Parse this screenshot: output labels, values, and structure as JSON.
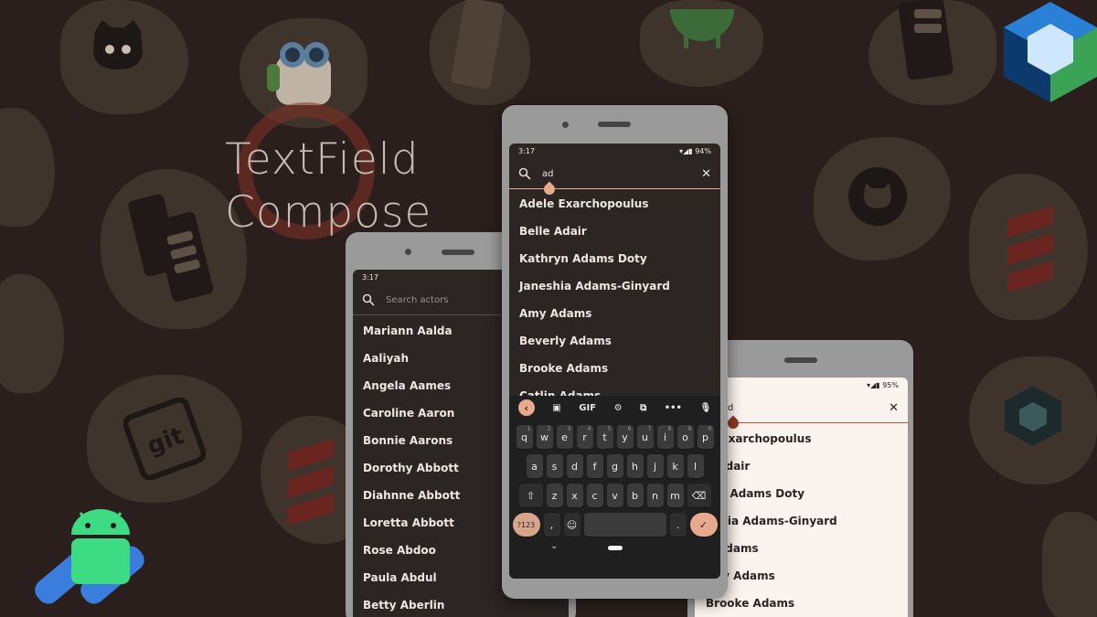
{
  "hero": {
    "title_line1": "TextField",
    "title_line2": "Compose"
  },
  "colors": {
    "background": "#2a1f1c",
    "blob": "#3e342b",
    "accent": "#e9a98c",
    "accent_light": "#b5573e",
    "dark_surface": "#2b2523",
    "light_surface": "#fbf3ee"
  },
  "left_phone": {
    "time": "3:17",
    "search_placeholder": "Search actors",
    "items": [
      "Mariann Aalda",
      "Aaliyah",
      "Angela Aames",
      "Caroline Aaron",
      "Bonnie Aarons",
      "Dorothy Abbott",
      "Diahnne Abbott",
      "Loretta Abbott",
      "Rose Abdoo",
      "Paula Abdul",
      "Betty Aberlin"
    ]
  },
  "center_phone": {
    "time": "3:17",
    "battery": "94%",
    "query": "ad",
    "items": [
      "Adele Exarchopoulus",
      "Belle Adair",
      "Kathryn Adams Doty",
      "Janeshia Adams-Ginyard",
      "Amy Adams",
      "Beverly Adams",
      "Brooke Adams",
      "Catlin Adams"
    ],
    "keyboard": {
      "toolbar": {
        "gif": "GIF"
      },
      "row1": [
        "q",
        "w",
        "e",
        "r",
        "t",
        "y",
        "u",
        "i",
        "o",
        "p"
      ],
      "row1_hints": [
        "1",
        "2",
        "3",
        "4",
        "5",
        "6",
        "7",
        "8",
        "9",
        "0"
      ],
      "row2": [
        "a",
        "s",
        "d",
        "f",
        "g",
        "h",
        "j",
        "k",
        "l"
      ],
      "row3": [
        "z",
        "x",
        "c",
        "v",
        "b",
        "n",
        "m"
      ],
      "symbols": "?123",
      "comma": ",",
      "period": "."
    }
  },
  "right_phone": {
    "battery": "95%",
    "query": "d",
    "items": [
      "le Exarchopoulus",
      "e Adair",
      "ryn Adams Doty",
      "eshia Adams-Ginyard",
      "y Adams",
      "erly Adams",
      "Brooke Adams"
    ]
  }
}
